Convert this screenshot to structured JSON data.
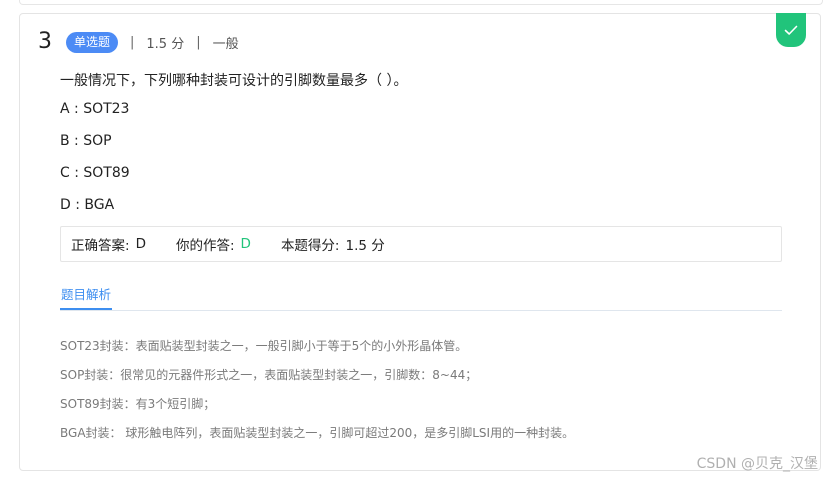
{
  "question": {
    "number": "3",
    "type_label": "单选题",
    "score": "1.5 分",
    "separator": "|",
    "difficulty": "一般",
    "stem": "一般情况下，下列哪种封装可设计的引脚数量最多（     ）。",
    "options": [
      "A : SOT23",
      "B : SOP",
      "C : SOT89",
      "D : BGA"
    ]
  },
  "answer": {
    "correct_label": "正确答案:",
    "correct_value": "D",
    "yours_label": "你的作答:",
    "yours_value": "D",
    "score_label": "本题得分:",
    "score_value": "1.5 分"
  },
  "analysis": {
    "tab_label": "题目解析",
    "lines": [
      "SOT23封装：表面贴装型封装之一，一般引脚小于等于5个的小外形晶体管。",
      "SOP封装：很常见的元器件形式之一，表面贴装型封装之一，引脚数：8~44；",
      "SOT89封装：有3个短引脚；",
      "BGA封装： 球形触电阵列，表面贴装型封装之一，引脚可超过200，是多引脚LSI用的一种封装。"
    ]
  },
  "watermark": "CSDN @贝克_汉堡",
  "colors": {
    "badge_blue": "#4c8bf5",
    "correct_green": "#21c47b",
    "tab_blue": "#3d8ef0"
  },
  "icons": {
    "status": "check-icon"
  }
}
